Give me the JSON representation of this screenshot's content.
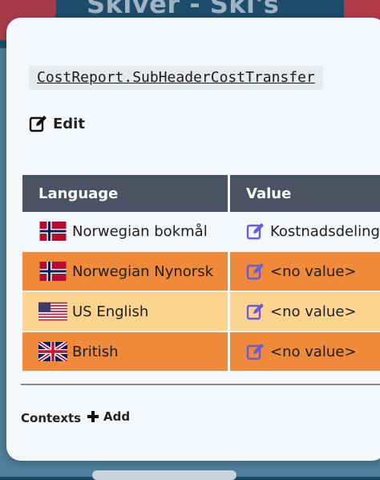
{
  "background": {
    "site_title": "Skiver - Ski's"
  },
  "modal": {
    "translation_key": "CostReport.SubHeaderCostTransfer",
    "edit_label": "Edit",
    "table": {
      "headers": [
        "Language",
        "Value"
      ],
      "rows": [
        {
          "flag": "norway-flag-icon",
          "language": "Norwegian bokmål",
          "value": "Kostnadsdeling",
          "style": "white"
        },
        {
          "flag": "norway-flag-icon",
          "language": "Norwegian Nynorsk",
          "value": "<no value>",
          "style": "orange"
        },
        {
          "flag": "us-flag-icon",
          "language": "US English",
          "value": "<no value>",
          "style": "light"
        },
        {
          "flag": "uk-flag-icon",
          "language": "British",
          "value": "<no value>",
          "style": "orange"
        }
      ]
    },
    "contexts_label": "Contexts",
    "add_label": "Add"
  },
  "colors": {
    "header_bg": "#4b5363",
    "orange_row": "#ee8a3a",
    "light_row": "#fbd590",
    "edit_icon": "#6b5bd6"
  }
}
